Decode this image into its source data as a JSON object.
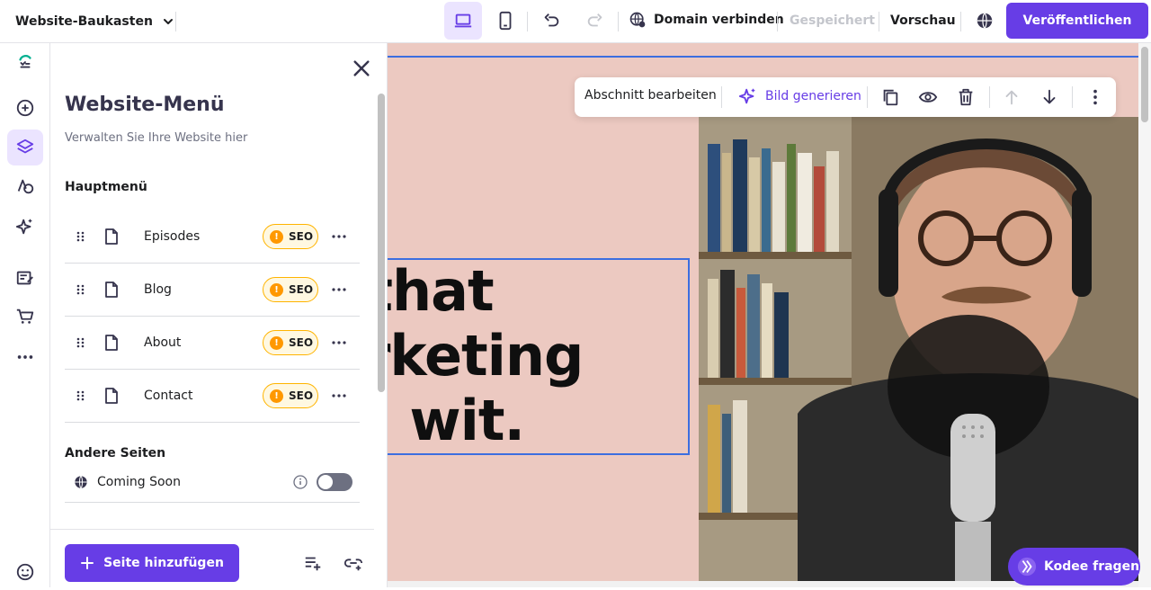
{
  "topbar": {
    "brand": "Website-Baukasten",
    "connect_domain": "Domain verbinden",
    "saved": "Gespeichert",
    "preview": "Vorschau",
    "publish": "Veröffentlichen"
  },
  "rail": {
    "icons": [
      "logo-icon",
      "add-element-icon",
      "layers-icon",
      "styles-icon",
      "ai-tools-icon",
      "blog-icon",
      "store-icon",
      "more-icon",
      "accessibility-icon"
    ],
    "active": "layers-icon"
  },
  "panel": {
    "title": "Website-Menü",
    "subtitle": "Verwalten Sie Ihre Website hier",
    "main_menu_heading": "Hauptmenü",
    "main_menu": [
      {
        "label": "Episodes",
        "badge": "SEO"
      },
      {
        "label": "Blog",
        "badge": "SEO"
      },
      {
        "label": "About",
        "badge": "SEO"
      },
      {
        "label": "Contact",
        "badge": "SEO"
      }
    ],
    "other_pages_heading": "Andere Seiten",
    "other_pages": [
      {
        "label": "Coming Soon",
        "toggle": false
      }
    ],
    "add_page": "Seite hinzufügen"
  },
  "section_toolbar": {
    "edit_section": "Abschnitt bearbeiten",
    "generate_image": "Bild generieren"
  },
  "canvas": {
    "headline_lines": [
      ": that",
      "arketing",
      "th wit."
    ]
  },
  "kodee": {
    "label": "Kodee fragen"
  },
  "colors": {
    "accent": "#673de6",
    "canvas_bg": "#ecc9c1",
    "selection": "#3c6ee0",
    "seo_border": "#ffb400"
  }
}
